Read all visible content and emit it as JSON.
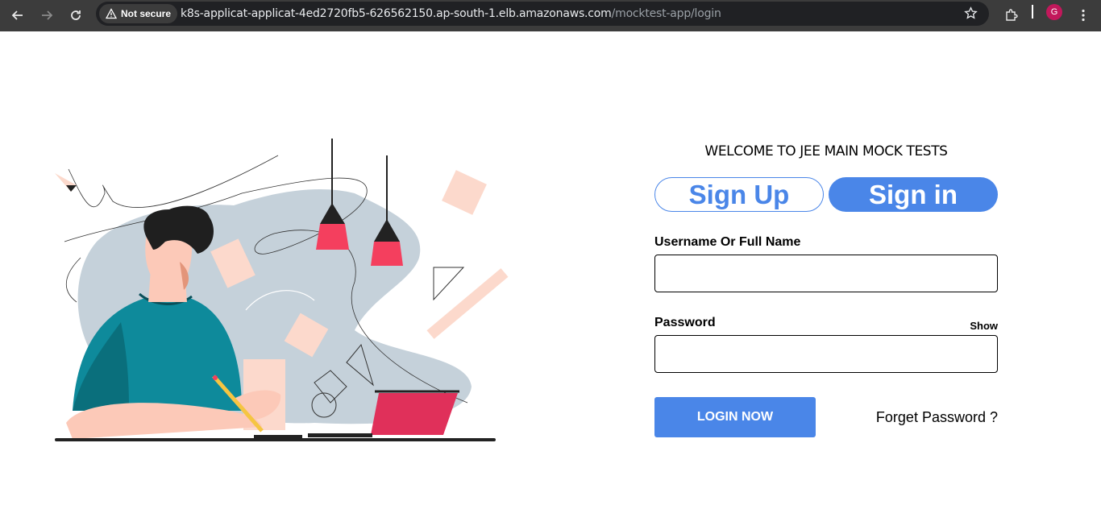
{
  "browser": {
    "security_label": "Not secure",
    "url_host": "k8s-applicat-applicat-4ed2720fb5-626562150.ap-south-1.elb.amazonaws.com",
    "url_path": "/mocktest-app/login",
    "profile_initial": "G"
  },
  "login": {
    "welcome": "WELCOME TO JEE MAIN MOCK TESTS",
    "tab_signup": "Sign Up",
    "tab_signin": "Sign in",
    "username_label": "Username Or Full Name",
    "username_value": "",
    "password_label": "Password",
    "password_value": "",
    "show_label": "Show",
    "login_button": "LOGIN NOW",
    "forget_link": "Forget Password ?"
  },
  "colors": {
    "accent": "#4a86e8",
    "chrome_bg": "#3c3c3c",
    "lamp": "#f43f5e",
    "shirt": "#0e8a9b",
    "blob": "#c5d1da"
  }
}
